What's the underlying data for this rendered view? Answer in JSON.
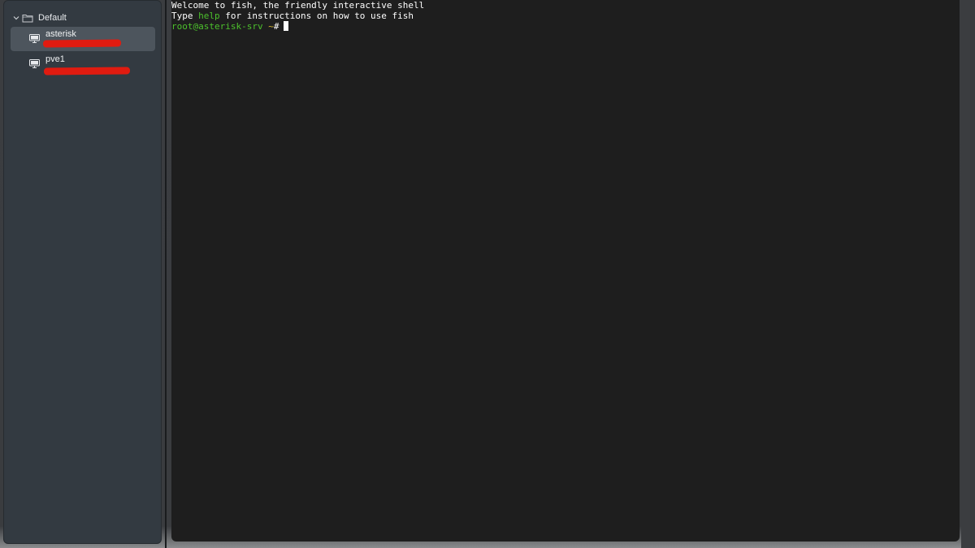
{
  "sidebar": {
    "group": {
      "label": "Default",
      "expanded": true
    },
    "hosts": [
      {
        "name": "asterisk",
        "selected": true
      },
      {
        "name": "pve1",
        "selected": false
      }
    ]
  },
  "terminal": {
    "welcome_line": "Welcome to fish, the friendly interactive shell",
    "help_prefix": "Type ",
    "help_keyword": "help",
    "help_suffix": " for instructions on how to use fish",
    "prompt_user_host": "root@asterisk-srv",
    "prompt_cwd": " ~",
    "prompt_symbol": "#"
  },
  "colors": {
    "terminal_bg": "#1e1e1e",
    "sidebar_bg": "#333a41",
    "prompt_green": "#4cc02c",
    "cwd_yellow": "#d7b92c",
    "redaction_red": "#e01b10"
  }
}
